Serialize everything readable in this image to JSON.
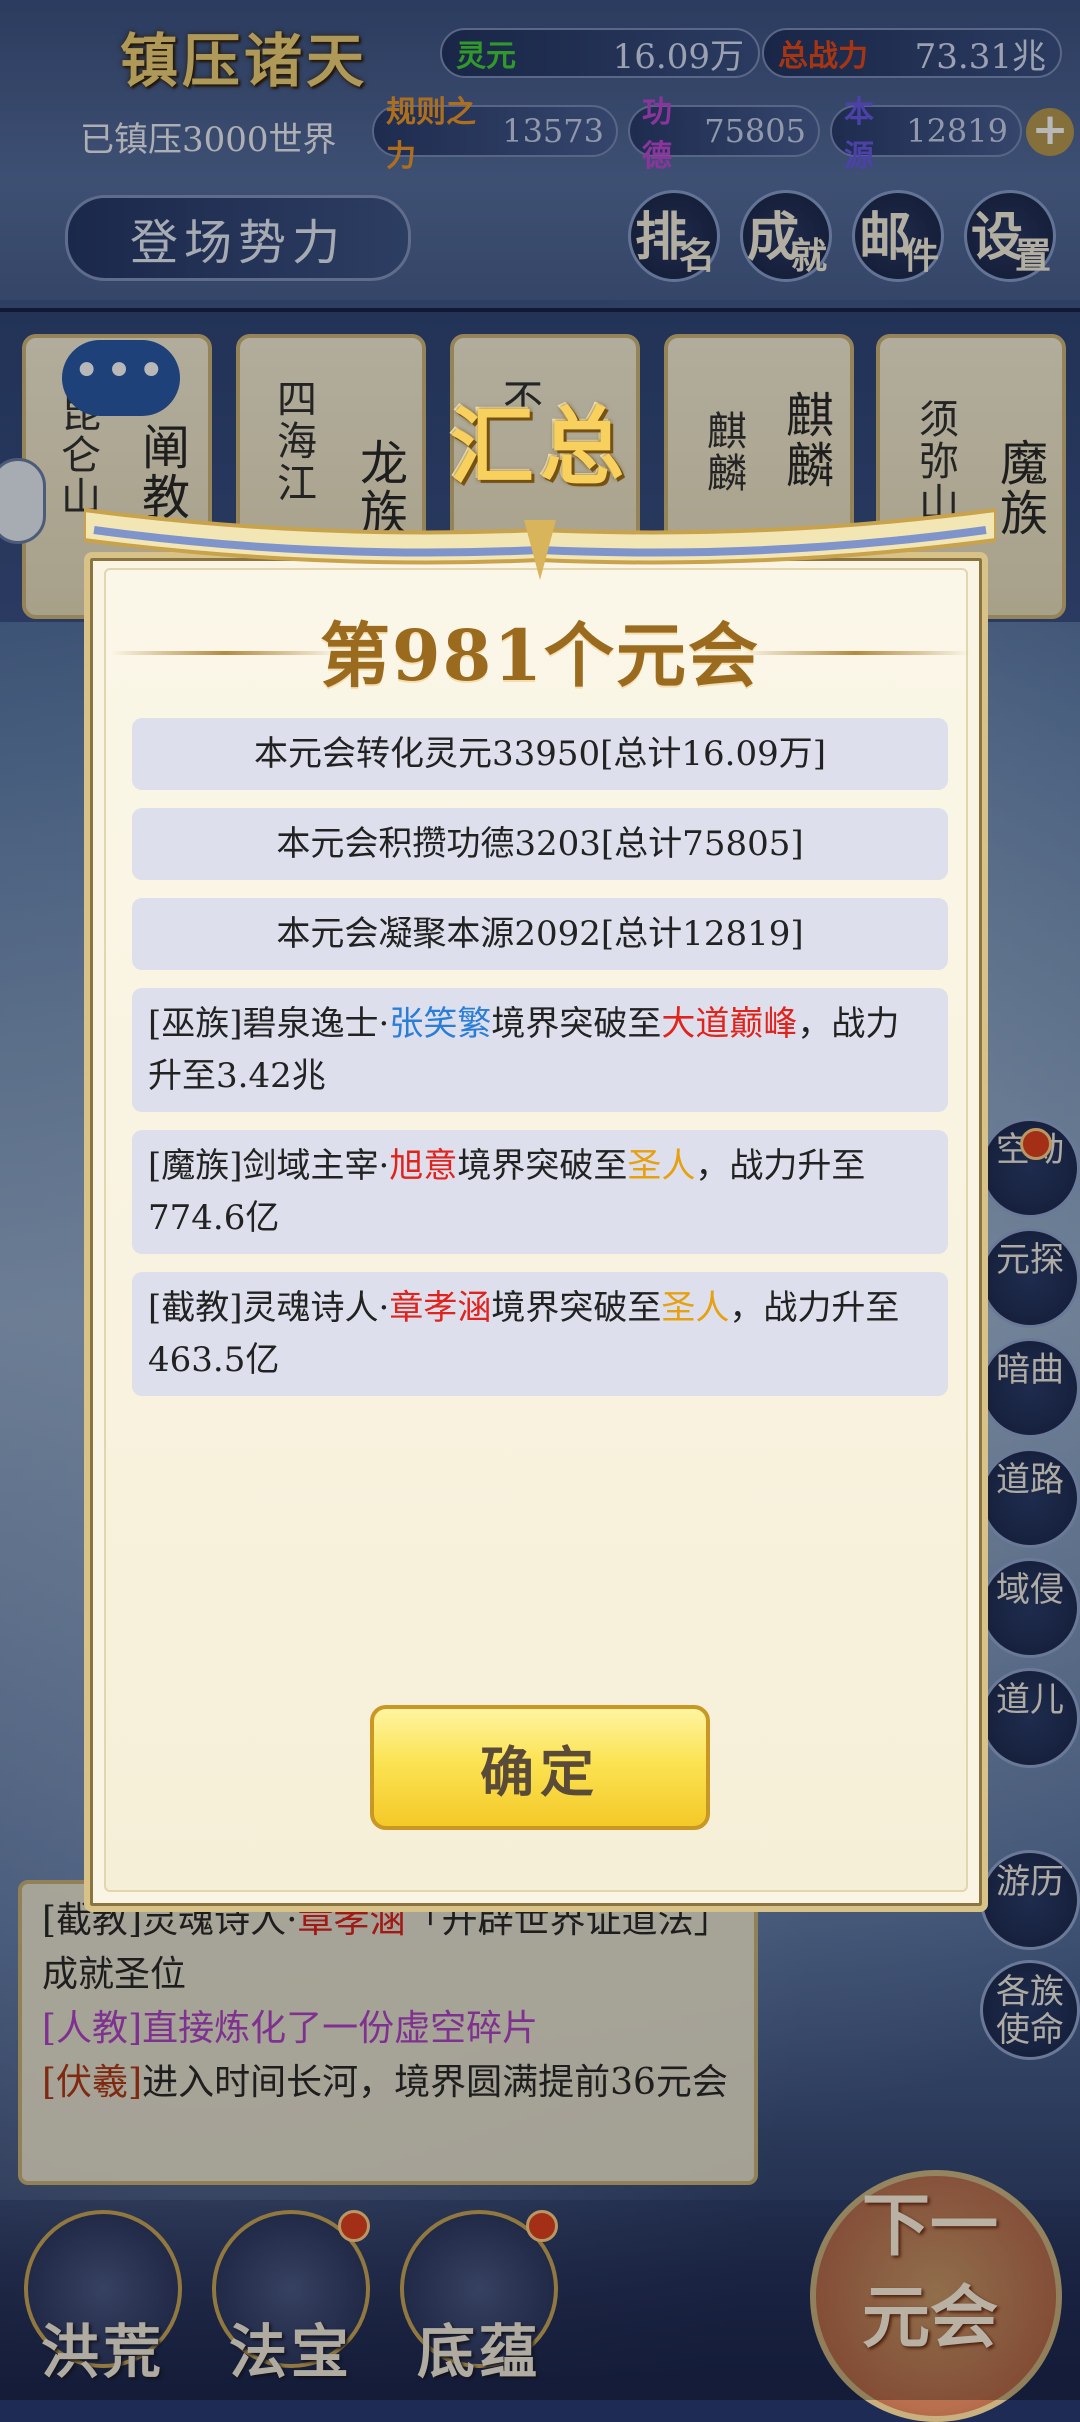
{
  "header": {
    "title": "镇压诸天",
    "spirit_label": "灵元",
    "spirit_value": "16.09万",
    "power_label": "总战力",
    "power_value": "73.31兆",
    "suppressed": "已镇压3000世界",
    "rule_label": "规则之力",
    "rule_value": "13573",
    "merit_label": "功德",
    "merit_value": "75805",
    "origin_label": "本源",
    "origin_value": "12819",
    "plus_icon": "plus-icon",
    "deploy_button": "登场势力",
    "buttons": [
      {
        "a": "排",
        "b": "名"
      },
      {
        "a": "成",
        "b": "就"
      },
      {
        "a": "邮",
        "b": "件"
      },
      {
        "a": "设",
        "b": "置"
      }
    ]
  },
  "factions": [
    {
      "name": "阐教",
      "sub": "昆仑山"
    },
    {
      "name": "龙族",
      "sub": "四海江"
    },
    {
      "name": "",
      "sub": "不"
    },
    {
      "name": "麒麟",
      "sub": "麒麟"
    },
    {
      "name": "魔族",
      "sub": "须弥山"
    }
  ],
  "chat_icon": "chat-bubble-icon",
  "side_buttons": [
    "空动",
    "元探",
    "暗曲",
    "道路",
    "域侵",
    "道儿",
    "游历",
    "各族使命"
  ],
  "log": {
    "line1_prefix": "[截教]灵魂诗人·",
    "line1_name": "章孝涵",
    "line1_rest": "「开辟世界证道法」成就圣位",
    "line2": "[人教]直接炼化了一份虚空碎片",
    "line3_tag": "[伏羲]",
    "line3_rest": "进入时间长河，境界圆满提前36元会"
  },
  "bottom_nav": [
    "洪荒",
    "法宝",
    "底蕴"
  ],
  "next_button": "下一元会",
  "modal": {
    "header": "汇总",
    "round_title": "第981个元会",
    "lines": [
      "本元会转化灵元33950[总计16.09万]",
      "本元会积攒功德3203[总计75805]",
      "本元会凝聚本源2092[总计12819]"
    ],
    "events": [
      {
        "prefix": "[巫族]碧泉逸士·",
        "name": "张笑繁",
        "mid": "境界突破至",
        "realm": "大道巅峰",
        "suffix": "，战力升至3.42兆",
        "name_color": "#2a7ed8",
        "realm_color": "#e0231c"
      },
      {
        "prefix": "[魔族]剑域主宰·",
        "name": "旭意",
        "mid": "境界突破至",
        "realm": "圣人",
        "suffix": "，战力升至774.6亿",
        "name_color": "#e0231c",
        "realm_color": "#e6a010"
      },
      {
        "prefix": "[截教]灵魂诗人·",
        "name": "章孝涵",
        "mid": "境界突破至",
        "realm": "圣人",
        "suffix": "，战力升至463.5亿",
        "name_color": "#e0231c",
        "realm_color": "#e6a010"
      }
    ],
    "confirm": "确定"
  }
}
